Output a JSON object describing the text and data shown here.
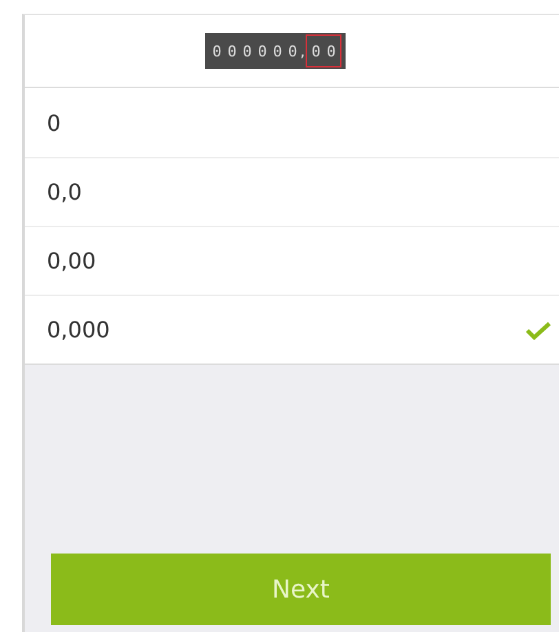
{
  "odometer": {
    "integer_digits": [
      "0",
      "0",
      "0",
      "0",
      "0",
      "0"
    ],
    "separator": ",",
    "decimal_digits": [
      "0",
      "0"
    ]
  },
  "options": [
    {
      "label": "0",
      "selected": false
    },
    {
      "label": "0,0",
      "selected": false
    },
    {
      "label": "0,00",
      "selected": false
    },
    {
      "label": "0,000",
      "selected": true
    }
  ],
  "next_button": {
    "label": "Next"
  }
}
